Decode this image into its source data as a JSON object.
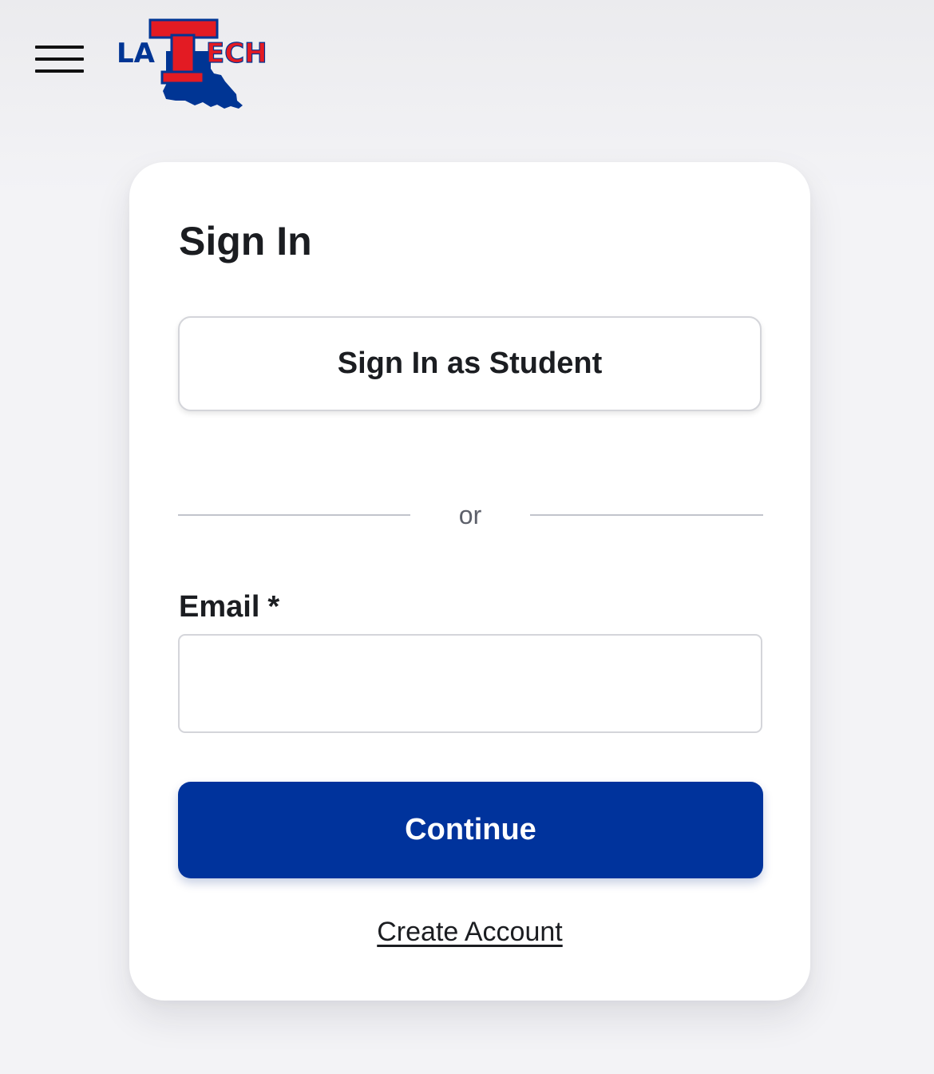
{
  "header": {
    "menu_icon": "hamburger-menu-icon",
    "logo": {
      "text_left": "LA",
      "text_right": "ECH",
      "letter_t": "T",
      "colors": {
        "red": "#e31b23",
        "blue": "#003594"
      }
    }
  },
  "signin": {
    "title": "Sign In",
    "student_button": "Sign In as Student",
    "divider_text": "or",
    "email_label": "Email",
    "required_mark": "*",
    "email_value": "",
    "email_placeholder": "",
    "continue_button": "Continue",
    "create_account_link": "Create Account"
  },
  "colors": {
    "primary": "#00339c",
    "background": "#f3f3f6",
    "card": "#ffffff",
    "text": "#1b1d21",
    "muted_text": "#5d606a",
    "border": "#d4d5da"
  }
}
